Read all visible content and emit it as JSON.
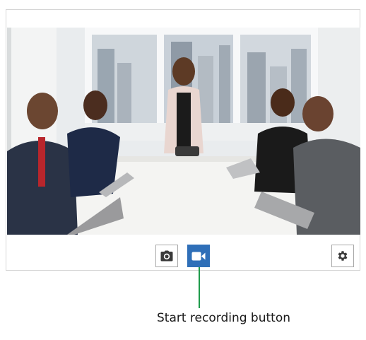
{
  "video_panel": {
    "scene": "meeting-room-photo"
  },
  "controls": {
    "snapshot": {
      "icon": "camera-icon"
    },
    "record": {
      "icon": "video-camera-icon",
      "state": "idle",
      "accent": "#2f6fb8"
    },
    "settings": {
      "icon": "gear-icon"
    }
  },
  "annotation": {
    "label": "Start recording button",
    "line_color": "#1f9b4b"
  }
}
